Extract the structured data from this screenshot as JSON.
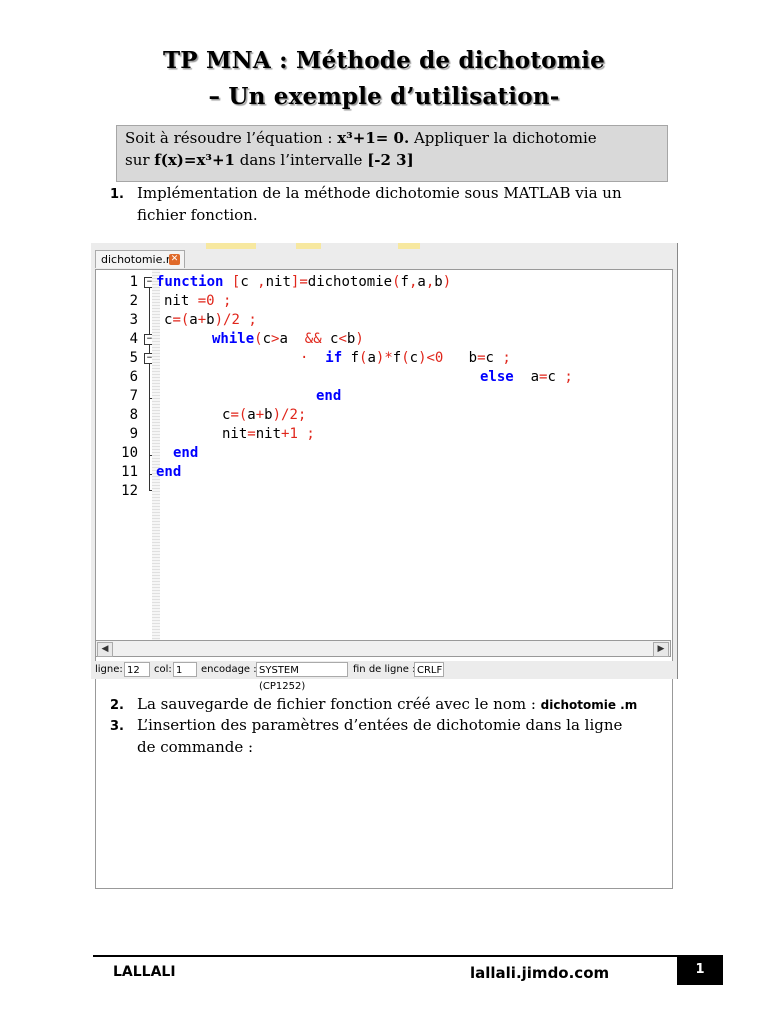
{
  "document": {
    "title_line1": "TP MNA : Méthode de dichotomie",
    "title_line2": "– Un exemple d’utilisation-",
    "task": {
      "part1": "Soit à résoudre l’équation : ",
      "equation": "x³+1= 0.",
      "part2": " Appliquer la dichotomie",
      "part3": "sur  ",
      "function": "f(x)=x³+1",
      "part4": " dans l’intervalle ",
      "interval": "[-2  3]"
    },
    "items": [
      {
        "num": "1.",
        "text": "Implémentation de la méthode  dichotomie  sous MATLAB via un fichier fonction."
      },
      {
        "num": "2.",
        "text": "La sauvegarde de fichier fonction créé avec le nom : ",
        "inline": "dichotomie .m"
      },
      {
        "num": "3.",
        "text": "L’insertion des paramètres d’entées de dichotomie   dans la ligne de commande :"
      }
    ]
  },
  "editor": {
    "tab_label": "dichotomie.m",
    "line_numbers": [
      "1",
      "2",
      "3",
      "4",
      "5",
      "6",
      "7",
      "8",
      "9",
      "10",
      "11",
      "12"
    ],
    "status": {
      "line_label": "ligne:",
      "line_value": "12",
      "col_label": "col:",
      "col_value": "1",
      "encoding_label": "encodage :",
      "encoding_value": "SYSTEM (CP1252)",
      "eol_label": "fin de ligne :",
      "eol_value": "CRLF"
    },
    "colors": {
      "keyword": "#0000ff",
      "operator": "#e0261b"
    }
  },
  "footer": {
    "author": "LALLALI",
    "site": "lallali.jimdo.com",
    "page": "1"
  }
}
